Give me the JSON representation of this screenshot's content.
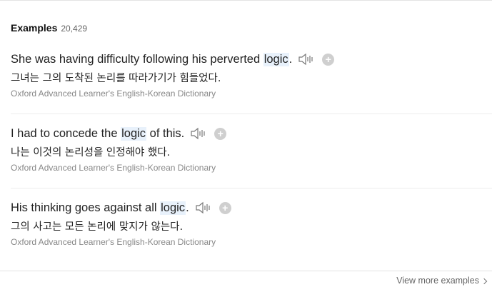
{
  "header": {
    "title": "Examples",
    "count": "20,429"
  },
  "examples": [
    {
      "en_before": "She was having difficulty following his perverted ",
      "en_highlight": "logic",
      "en_after": ".",
      "ko": "그녀는 그의 도착된 논리를 따라가기가 힘들었다.",
      "source": "Oxford Advanced Learner's English-Korean Dictionary"
    },
    {
      "en_before": "I had to concede the ",
      "en_highlight": "logic",
      "en_after": " of this.",
      "ko": "나는 이것의 논리성을 인정해야 했다.",
      "source": "Oxford Advanced Learner's English-Korean Dictionary"
    },
    {
      "en_before": "His thinking goes against all ",
      "en_highlight": "logic",
      "en_after": ".",
      "ko": "그의 사고는 모든 논리에 맞지가 않는다.",
      "source": "Oxford Advanced Learner's English-Korean Dictionary"
    }
  ],
  "footer": {
    "view_more_label": "View more examples"
  },
  "icons": {
    "speaker": "speaker-icon",
    "add": "add-icon",
    "chevron": "chevron-right-icon"
  },
  "colors": {
    "highlight": "#e8f1fb",
    "plus_button": "#cfcfcf",
    "source_text": "#888888"
  }
}
